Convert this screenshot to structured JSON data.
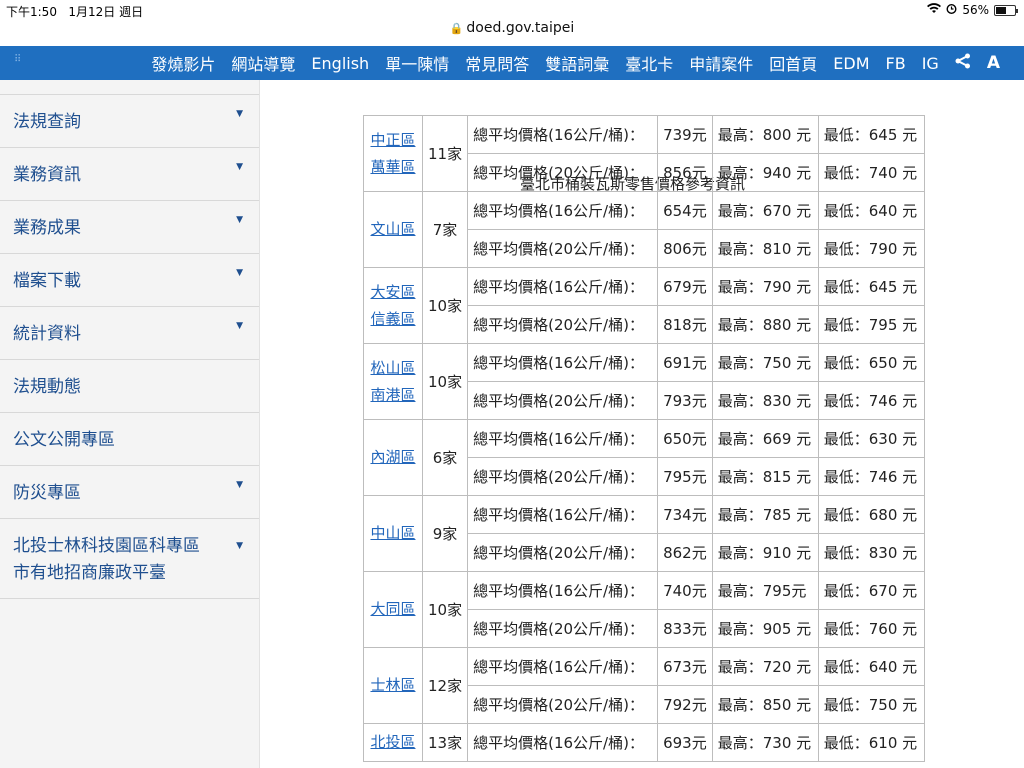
{
  "status_bar": {
    "time": "下午1:50",
    "date": "1月12日 週日",
    "battery": "56%",
    "battery_level": 0.56
  },
  "browser": {
    "url": "doed.gov.taipei"
  },
  "nav": {
    "items": [
      "發燒影片",
      "網站導覽",
      "English",
      "單一陳情",
      "常見問答",
      "雙語詞彙",
      "臺北卡",
      "申請案件",
      "回首頁",
      "EDM",
      "FB",
      "IG"
    ],
    "icons": [
      "share-icon",
      "font-size-icon"
    ]
  },
  "sidebar": {
    "items": [
      {
        "label": "法規查詢",
        "has_caret": true
      },
      {
        "label": "業務資訊",
        "has_caret": true
      },
      {
        "label": "業務成果",
        "has_caret": true
      },
      {
        "label": "檔案下載",
        "has_caret": true
      },
      {
        "label": "統計資料",
        "has_caret": true
      },
      {
        "label": "法規動態",
        "has_caret": false
      },
      {
        "label": "公文公開專區",
        "has_caret": false
      },
      {
        "label": "防災專區",
        "has_caret": true
      },
      {
        "label": "北投士林科技園區科專區市有地招商廉政平臺",
        "line1": "北投士林科技園區科專區",
        "line2": "市有地招商廉政平臺",
        "has_caret": true
      }
    ]
  },
  "price_table": {
    "title": "臺北市桶裝瓦斯零售價格參考資訊",
    "row_label_16": "總平均價格(16公斤/桶)：",
    "row_label_20": "總平均價格(20公斤/桶)：",
    "groups": [
      {
        "districts": [
          "中正區",
          "萬華區"
        ],
        "count": "11家",
        "rows": [
          {
            "avg": "739元",
            "high": "最高：800 元",
            "low": "最低：645 元"
          },
          {
            "avg": "856元",
            "high": "最高：940 元",
            "low": "最低：740 元"
          }
        ]
      },
      {
        "districts": [
          "文山區"
        ],
        "count": "7家",
        "rows": [
          {
            "avg": "654元",
            "high": "最高：670 元",
            "low": "最低：640 元"
          },
          {
            "avg": "806元",
            "high": "最高：810 元",
            "low": "最低：790 元"
          }
        ]
      },
      {
        "districts": [
          "大安區",
          "信義區"
        ],
        "count": "10家",
        "rows": [
          {
            "avg": "679元",
            "high": "最高：790 元",
            "low": "最低：645 元"
          },
          {
            "avg": "818元",
            "high": "最高：880 元",
            "low": "最低：795 元"
          }
        ]
      },
      {
        "districts": [
          "松山區",
          "南港區"
        ],
        "count": "10家",
        "rows": [
          {
            "avg": "691元",
            "high": "最高：750 元",
            "low": "最低：650 元"
          },
          {
            "avg": "793元",
            "high": "最高：830 元",
            "low": "最低：746 元"
          }
        ]
      },
      {
        "districts": [
          "內湖區"
        ],
        "count": "6家",
        "rows": [
          {
            "avg": "650元",
            "high": "最高：669 元",
            "low": "最低：630 元"
          },
          {
            "avg": "795元",
            "high": "最高：815 元",
            "low": "最低：746 元"
          }
        ]
      },
      {
        "districts": [
          "中山區"
        ],
        "count": "9家",
        "rows": [
          {
            "avg": "734元",
            "high": "最高：785 元",
            "low": "最低：680 元"
          },
          {
            "avg": "862元",
            "high": "最高：910 元",
            "low": "最低：830 元"
          }
        ]
      },
      {
        "districts": [
          "大同區"
        ],
        "count": "10家",
        "rows": [
          {
            "avg": "740元",
            "high": "最高：795元",
            "low": "最低：670 元"
          },
          {
            "avg": "833元",
            "high": "最高：905 元",
            "low": "最低：760 元"
          }
        ]
      },
      {
        "districts": [
          "士林區"
        ],
        "count": "12家",
        "rows": [
          {
            "avg": "673元",
            "high": "最高：720 元",
            "low": "最低：640 元"
          },
          {
            "avg": "792元",
            "high": "最高：850 元",
            "low": "最低：750 元"
          }
        ]
      },
      {
        "districts": [
          "北投區"
        ],
        "count": "13家",
        "rows": [
          {
            "avg": "693元",
            "high": "最高：730 元",
            "low": "最低：610 元"
          }
        ]
      }
    ]
  }
}
